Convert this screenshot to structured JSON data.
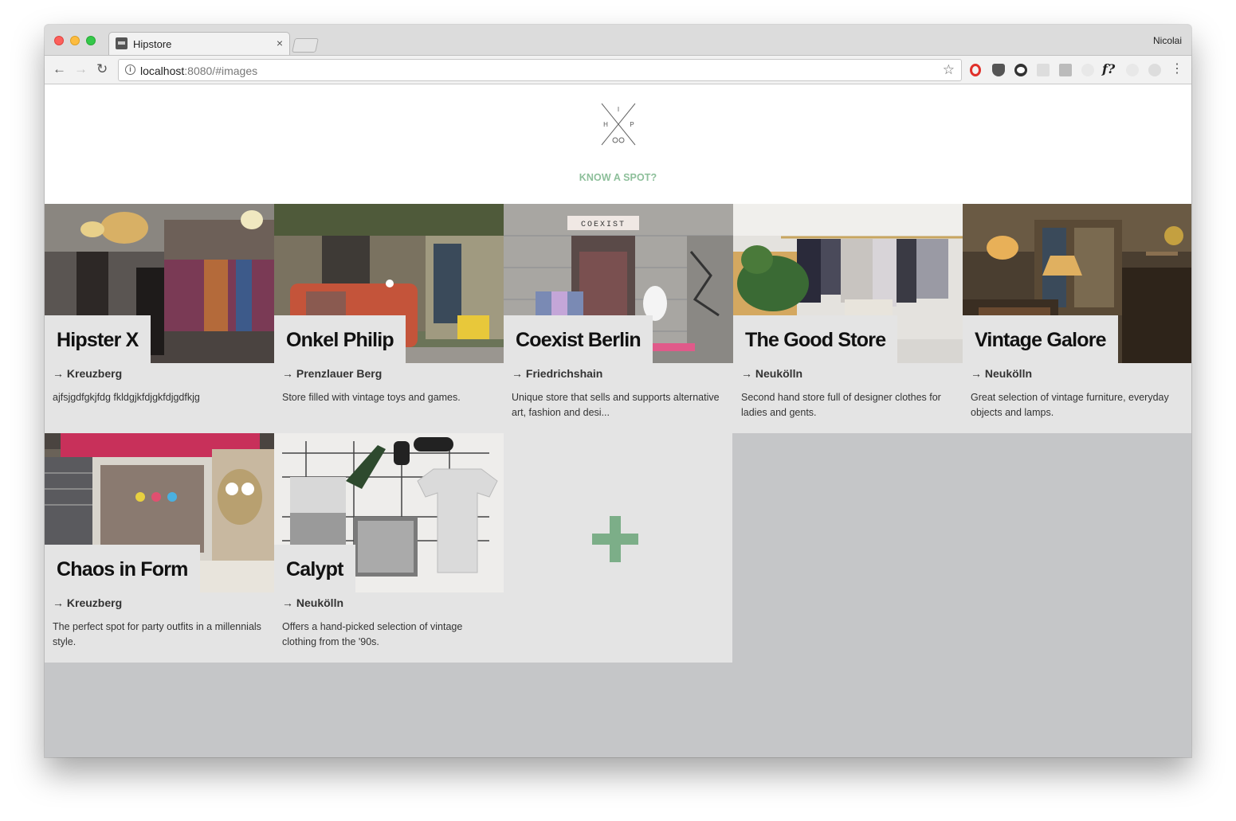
{
  "browser": {
    "tab_title": "Hipstore",
    "tab_close": "×",
    "profile_name": "Nicolai",
    "url_host": "localhost",
    "url_rest": ":8080/#images",
    "back_glyph": "←",
    "forward_glyph": "→",
    "reload_glyph": "↻",
    "star_glyph": "☆",
    "info_glyph": "i",
    "ext_f_glyph": "f?",
    "menu_glyph": "⋮"
  },
  "site": {
    "logo_letters": [
      "I",
      "H",
      "P"
    ],
    "cta_label": "KNOW A SPOT?",
    "accent_color": "#8dbf9a"
  },
  "stores": [
    {
      "name": "Hipster X",
      "district": "→ Kreuzberg",
      "description": "ajfsjgdfgkjfdg fkldgjkfdjgkfdjgdfkjg"
    },
    {
      "name": "Onkel Philip",
      "district": "→ Prenzlauer Berg",
      "description": "Store filled with vintage toys and games."
    },
    {
      "name": "Coexist Berlin",
      "district": "→ Friedrichshain",
      "description": "Unique store that sells and supports alternative art, fashion and desi..."
    },
    {
      "name": "The Good Store",
      "district": "→ Neukölln",
      "description": "Second hand store full of designer clothes for ladies and gents."
    },
    {
      "name": "Vintage Galore",
      "district": "→ Neukölln",
      "description": "Great selection of vintage furniture, everyday objects and lamps."
    },
    {
      "name": "Chaos in Form",
      "district": "→ Kreuzberg",
      "description": "The perfect spot for party outfits in a millennials style."
    },
    {
      "name": "Calypt",
      "district": "→ Neukölln",
      "description": "Offers a hand-picked selection of vintage clothing from the '90s."
    }
  ],
  "photo_sign": "COEXIST"
}
